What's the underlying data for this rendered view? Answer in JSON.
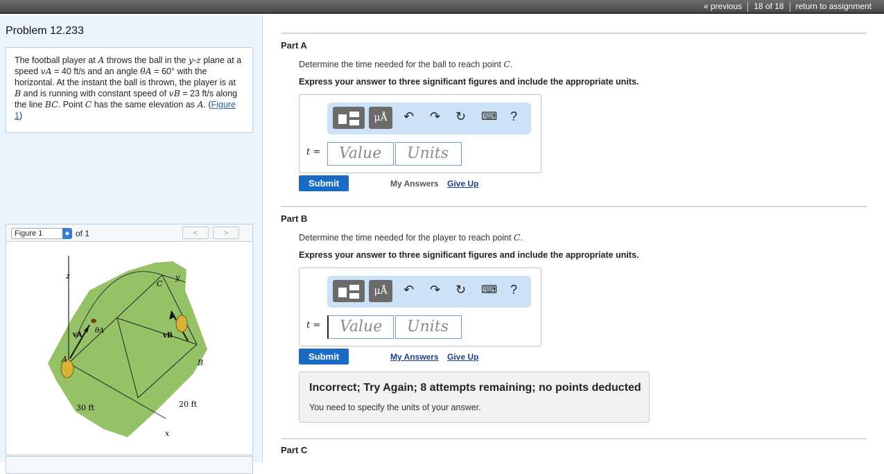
{
  "nav": {
    "previous": "« previous",
    "position": "18 of 18",
    "return": "return to assignment"
  },
  "problem": {
    "title": "Problem 12.233",
    "text_1": "The football player at ",
    "var_A": "A",
    "text_2": " throws the ball in the ",
    "plane": "y-z",
    "text_3": " plane at a speed ",
    "vA_sym": "vA",
    "text_4": " = 40  ft/s and an angle ",
    "thetaA_sym": "θA",
    "text_5": " = 60° with the horizontal. At the instant the ball is thrown, the player is at ",
    "var_B": "B",
    "text_6": " and is running with constant speed of ",
    "vB_sym": "vB",
    "text_7": " = 23  ft/s along the line ",
    "var_BC": "BC",
    "text_8": ". Point ",
    "var_C": "C",
    "text_9": " has the same elevation as ",
    "var_A2": "A",
    "text_10": ". (",
    "figure_link": "Figure 1",
    "text_11": ")"
  },
  "figure": {
    "select_label": "Figure 1",
    "of_label": "of 1",
    "prev_icon": "<",
    "next_icon": ">",
    "labels": {
      "z": "z",
      "y": "y",
      "x": "x",
      "C": "C",
      "B": "B",
      "A": "A",
      "vA": "vA",
      "thetaA": "θA",
      "vB": "vB",
      "dim30": "30 ft",
      "dim20": "20 ft"
    }
  },
  "partA": {
    "title": "Part A",
    "question": "Determine the time needed for the ball to reach point ",
    "question_var": "C",
    "question_end": ".",
    "instruction": "Express your answer to three significant figures and include the appropriate units.",
    "var_label": "t =",
    "value_placeholder": "Value",
    "units_placeholder": "Units",
    "submit": "Submit",
    "my_answers": "My Answers",
    "give_up": "Give Up"
  },
  "partB": {
    "title": "Part B",
    "question": "Determine the time needed for the player to reach point ",
    "question_var": "C",
    "question_end": ".",
    "instruction": "Express your answer to three significant figures and include the appropriate units.",
    "var_label": "t =",
    "value_placeholder": "Value",
    "units_placeholder": "Units",
    "submit": "Submit",
    "my_answers": "My Answers",
    "give_up": "Give Up",
    "feedback_title": "Incorrect; Try Again; 8 attempts remaining; no points deducted",
    "feedback_msg": "You need to specify the units of your answer."
  },
  "partC": {
    "title": "Part C"
  },
  "toolbar": {
    "units_btn": "μÅ",
    "undo": "↶",
    "redo": "↷",
    "reset": "↻",
    "keyboard": "⌨",
    "help": "?"
  },
  "colors": {
    "accent": "#1a6bc6",
    "toolbar_bg": "#cde2f6",
    "panel_bg": "#eaf4fc",
    "field_green": "#95c167"
  }
}
